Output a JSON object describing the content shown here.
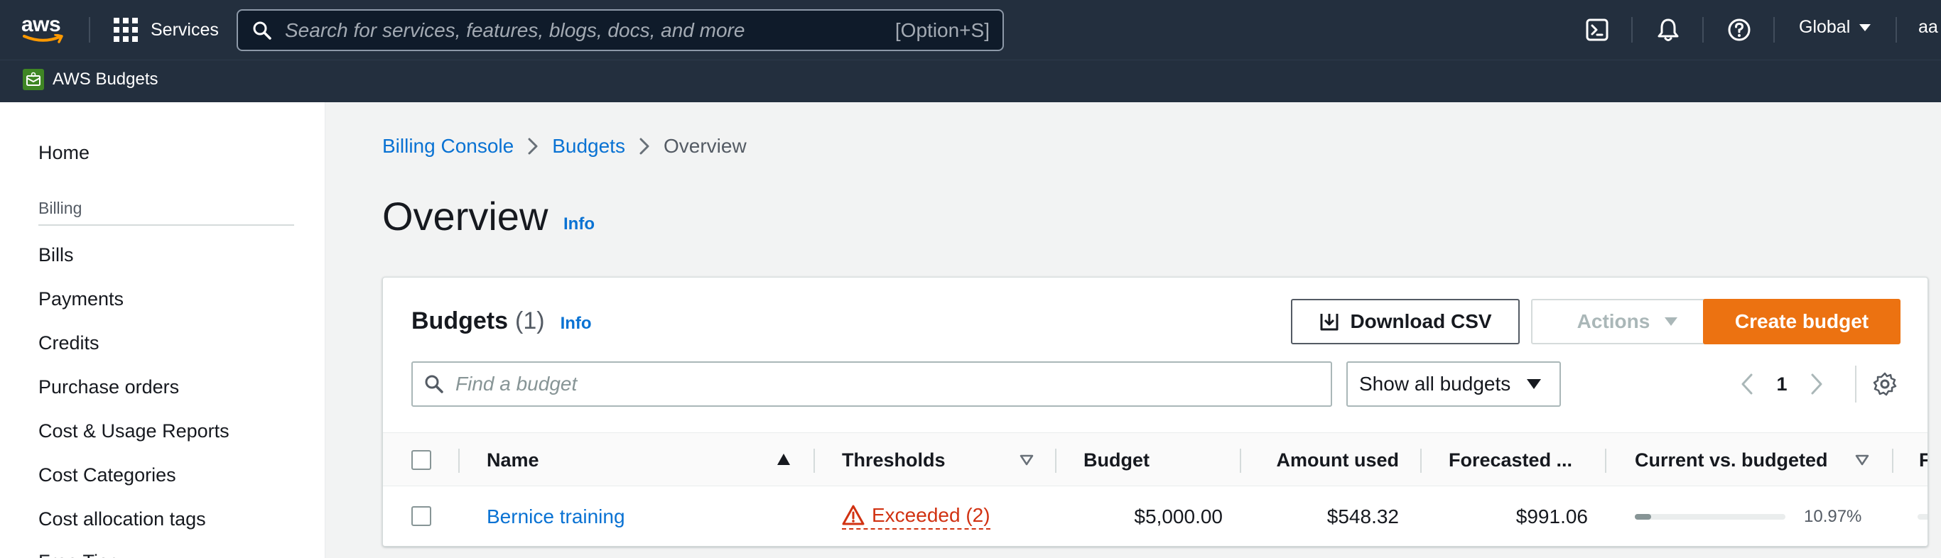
{
  "topnav": {
    "logo_text": "aws",
    "services_label": "Services",
    "search_placeholder": "Search for services, features, blogs, docs, and more",
    "search_shortcut": "[Option+S]",
    "region": "Global",
    "account_fragment": "aa"
  },
  "subnav": {
    "service_name": "AWS Budgets"
  },
  "sidebar": {
    "home": "Home",
    "section_billing": "Billing",
    "items": [
      {
        "label": "Bills"
      },
      {
        "label": "Payments"
      },
      {
        "label": "Credits"
      },
      {
        "label": "Purchase orders"
      },
      {
        "label": "Cost & Usage Reports"
      },
      {
        "label": "Cost Categories"
      },
      {
        "label": "Cost allocation tags"
      },
      {
        "label": "Free Tier"
      }
    ]
  },
  "breadcrumb": [
    {
      "label": "Billing Console"
    },
    {
      "label": "Budgets"
    },
    {
      "label": "Overview"
    }
  ],
  "page": {
    "title": "Overview",
    "info": "Info"
  },
  "budgets_panel": {
    "title": "Budgets",
    "count": "(1)",
    "info": "Info",
    "download_csv": "Download CSV",
    "actions": "Actions",
    "create_budget": "Create budget",
    "find_placeholder": "Find a budget",
    "filter_selected": "Show all budgets",
    "current_page": "1"
  },
  "table": {
    "columns": {
      "name": "Name",
      "thresholds": "Thresholds",
      "budget": "Budget",
      "amount_used": "Amount used",
      "forecasted": "Forecasted ...",
      "current_vs_budgeted": "Current vs. budgeted",
      "next_partial": "F"
    },
    "rows": [
      {
        "name": "Bernice training",
        "thresholds": "Exceeded (2)",
        "budget": "$5,000.00",
        "amount_used": "$548.32",
        "forecasted": "$991.06",
        "current_vs_budgeted_pct": "10.97%",
        "current_vs_budgeted_fraction": 0.1097
      }
    ]
  },
  "colors": {
    "nav_bg": "#232f3e",
    "link_blue": "#0972d3",
    "primary_orange": "#ec7211",
    "error_red": "#d13212"
  }
}
